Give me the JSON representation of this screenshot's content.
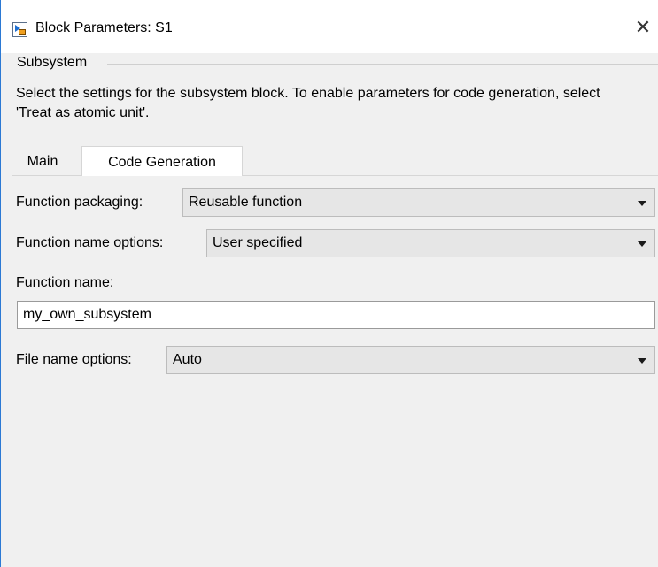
{
  "window": {
    "title": "Block Parameters: S1",
    "close_glyph": "✕",
    "icon": "simulink-block-icon",
    "accent_color": "#2b79d4"
  },
  "group": {
    "label": "Subsystem",
    "description": "Select the settings for the subsystem block. To enable parameters for code generation, select 'Treat as atomic unit'."
  },
  "tabs": [
    {
      "label": "Main",
      "selected": false
    },
    {
      "label": "Code Generation",
      "selected": true
    }
  ],
  "code_generation": {
    "function_packaging": {
      "label": "Function packaging:",
      "value": "Reusable function"
    },
    "function_name_options": {
      "label": "Function name options:",
      "value": "User specified"
    },
    "function_name": {
      "label": "Function name:",
      "value": "my_own_subsystem"
    },
    "file_name_options": {
      "label": "File name options:",
      "value": "Auto"
    }
  }
}
